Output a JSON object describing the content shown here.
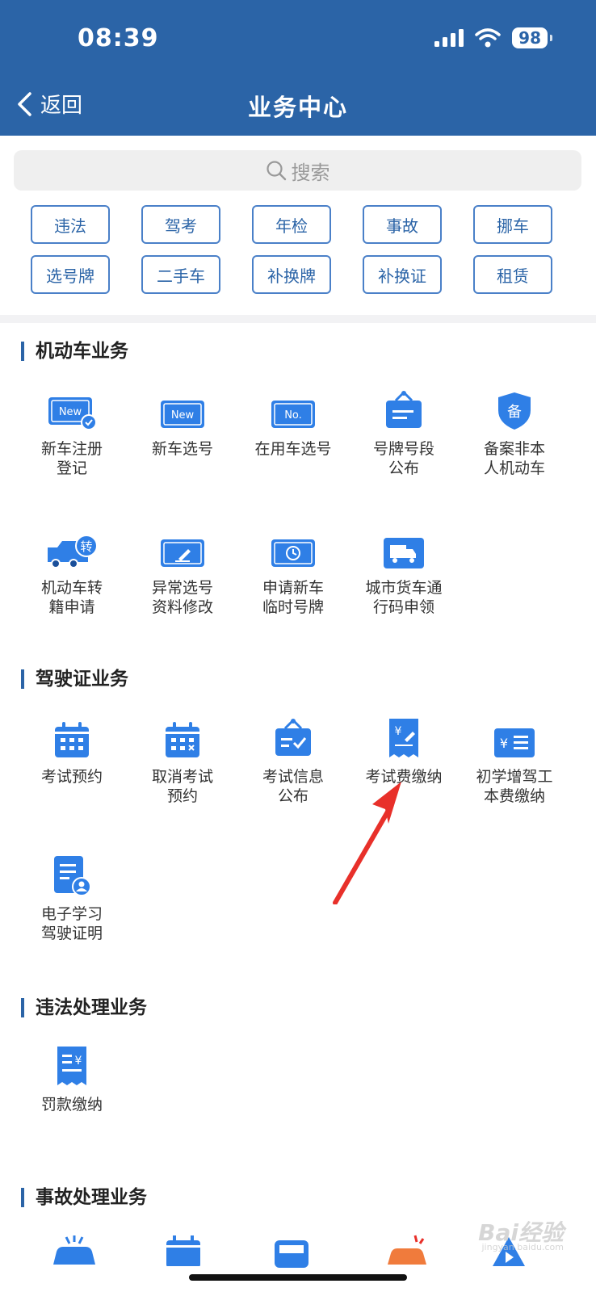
{
  "status": {
    "time": "08:39",
    "battery": "98"
  },
  "nav": {
    "back_label": "返回",
    "title": "业务中心"
  },
  "search": {
    "placeholder": "搜索"
  },
  "quick_tags": [
    "违法",
    "驾考",
    "年检",
    "事故",
    "挪车",
    "选号牌",
    "二手车",
    "补换牌",
    "补换证",
    "租赁"
  ],
  "sections": {
    "motor": {
      "title": "机动车业务",
      "items": [
        {
          "label": "新车注册\n登记",
          "icon": "new-plate-check-icon"
        },
        {
          "label": "新车选号",
          "icon": "new-plate-icon"
        },
        {
          "label": "在用车选号",
          "icon": "number-plate-icon"
        },
        {
          "label": "号牌号段\n公布",
          "icon": "notice-board-icon"
        },
        {
          "label": "备案非本\n人机动车",
          "icon": "shield-bei-icon"
        },
        {
          "label": "机动车转\n籍申请",
          "icon": "truck-transfer-icon"
        },
        {
          "label": "异常选号\n资料修改",
          "icon": "plate-edit-icon"
        },
        {
          "label": "申请新车\n临时号牌",
          "icon": "plate-clock-icon"
        },
        {
          "label": "城市货车通\n行码申领",
          "icon": "truck-pass-icon"
        }
      ]
    },
    "license": {
      "title": "驾驶证业务",
      "items": [
        {
          "label": "考试预约",
          "icon": "calendar-icon"
        },
        {
          "label": "取消考试\n预约",
          "icon": "calendar-cancel-icon"
        },
        {
          "label": "考试信息\n公布",
          "icon": "notice-check-icon"
        },
        {
          "label": "考试费缴纳",
          "icon": "fee-receipt-icon"
        },
        {
          "label": "初学增驾工\n本费缴纳",
          "icon": "yuan-card-icon"
        },
        {
          "label": "电子学习\n驾驶证明",
          "icon": "doc-user-icon"
        }
      ]
    },
    "violation": {
      "title": "违法处理业务",
      "items": [
        {
          "label": "罚款缴纳",
          "icon": "fine-receipt-icon"
        }
      ]
    },
    "accident": {
      "title": "事故处理业务"
    }
  },
  "watermark": {
    "brand": "Bai经验",
    "url": "jingyan.baidu.com"
  },
  "colors": {
    "primary": "#2b64a7",
    "icon_blue": "#2f7fe6",
    "arrow_red": "#e8302a"
  }
}
